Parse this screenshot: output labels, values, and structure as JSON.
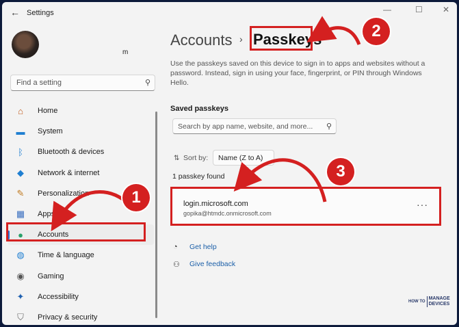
{
  "window": {
    "title": "Settings",
    "back_glyph": "←",
    "minimize_glyph": "—",
    "maximize_glyph": "☐",
    "close_glyph": "✕"
  },
  "profile": {
    "name_suffix": "m"
  },
  "sidebar": {
    "search_placeholder": "Find a setting",
    "items": [
      {
        "label": "Home",
        "icon": "home-icon",
        "active": false
      },
      {
        "label": "System",
        "icon": "system-icon",
        "active": false
      },
      {
        "label": "Bluetooth & devices",
        "icon": "bluetooth-icon",
        "active": false
      },
      {
        "label": "Network & internet",
        "icon": "wifi-icon",
        "active": false
      },
      {
        "label": "Personalization",
        "icon": "brush-icon",
        "active": false
      },
      {
        "label": "Apps",
        "icon": "apps-icon",
        "active": false
      },
      {
        "label": "Accounts",
        "icon": "accounts-icon",
        "active": true
      },
      {
        "label": "Time & language",
        "icon": "globe-icon",
        "active": false
      },
      {
        "label": "Gaming",
        "icon": "gamepad-icon",
        "active": false
      },
      {
        "label": "Accessibility",
        "icon": "accessibility-icon",
        "active": false
      },
      {
        "label": "Privacy & security",
        "icon": "shield-icon",
        "active": false
      }
    ]
  },
  "main": {
    "breadcrumb_parent": "Accounts",
    "breadcrumb_separator": "›",
    "breadcrumb_current": "Passkeys",
    "description": "Use the passkeys saved on this device to sign in to apps and websites without a password. Instead, sign in using your face, fingerprint, or PIN through Windows Hello.",
    "saved_title": "Saved passkeys",
    "search_placeholder": "Search by app name, website, and more...",
    "sort_label": "Sort by:",
    "sort_value": "Name (Z to A)",
    "count_text": "1 passkey found",
    "passkey": {
      "site": "login.microsoft.com",
      "user": "gopika@htmdc.onmicrosoft.com",
      "more": "···"
    },
    "get_help": "Get help",
    "give_feedback": "Give feedback"
  },
  "annotations": {
    "badge1": "1",
    "badge2": "2",
    "badge3": "3",
    "color": "#d42020"
  },
  "watermark": {
    "line1": "HOW TO",
    "line2a": "MANAGE",
    "line2b": "DEVICES"
  }
}
